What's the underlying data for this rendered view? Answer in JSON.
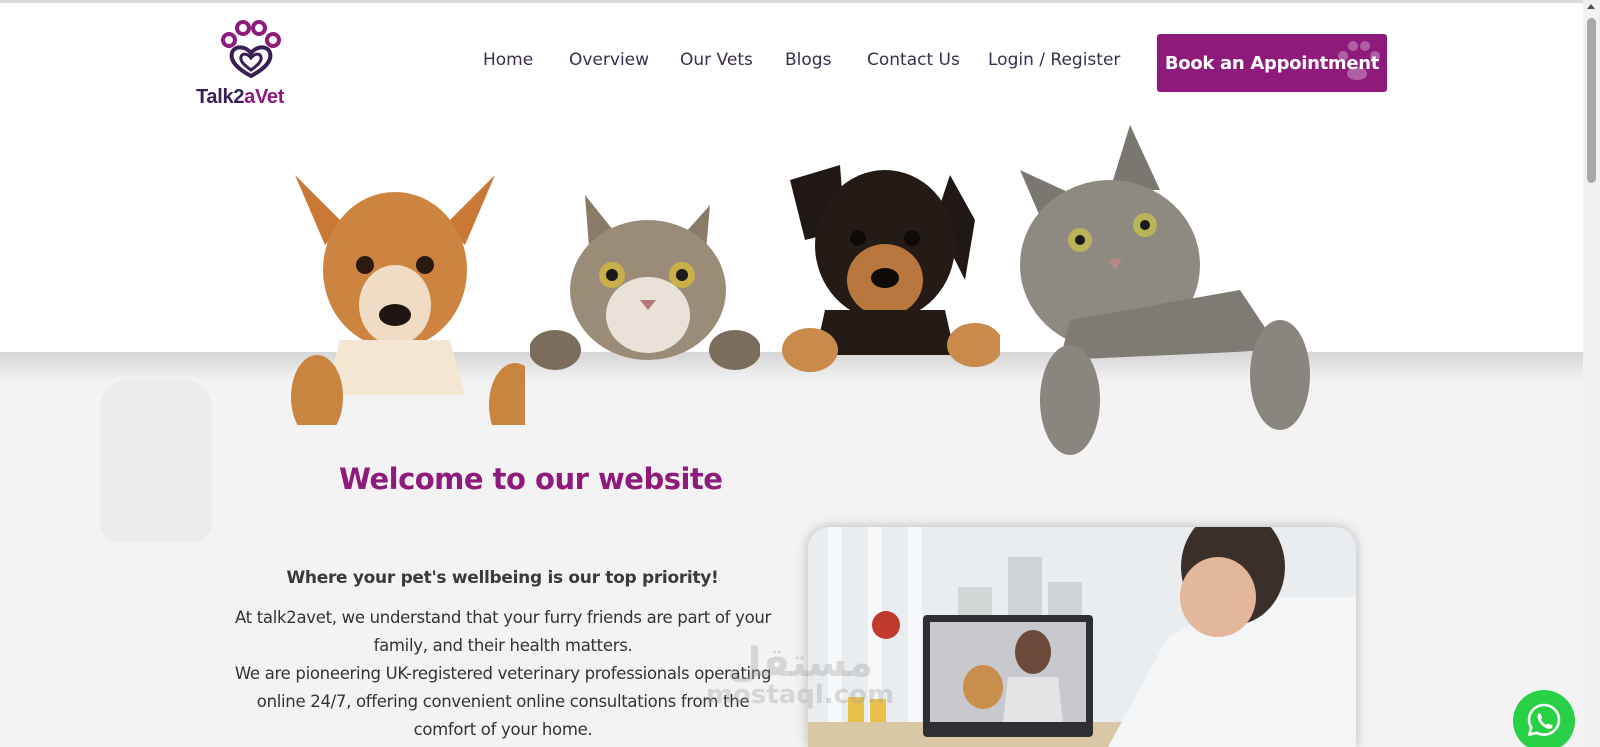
{
  "brand": {
    "name_part1": "Talk2",
    "name_part2": "aVet",
    "logo_icon": "paw-heart-icon",
    "primary_color": "#8e1a7c",
    "dark_color": "#3a1f55"
  },
  "nav": {
    "items": [
      {
        "label": "Home"
      },
      {
        "label": "Overview"
      },
      {
        "label": "Our Vets"
      },
      {
        "label": "Blogs"
      },
      {
        "label": "Contact Us"
      },
      {
        "label": "Login / Register"
      }
    ],
    "cta_label": "Book an Appointment"
  },
  "hero": {
    "image": "dogs-and-cats-peeking-over-banner"
  },
  "welcome": {
    "heading": "Welcome to our website",
    "tagline": "Where your pet's wellbeing is our top priority!",
    "paragraph1": "At talk2avet, we understand that your furry friends are part of your family, and their health matters.",
    "paragraph2": "We are pioneering UK-registered veterinary professionals operating online 24/7, offering convenient online consultations from the comfort of your home."
  },
  "photo": {
    "image": "vet-video-consultation-photo"
  },
  "watermark": {
    "arabic": "مستقل",
    "latin": "mostaql.com"
  },
  "whatsapp": {
    "icon": "whatsapp-icon",
    "color": "#27d045"
  }
}
